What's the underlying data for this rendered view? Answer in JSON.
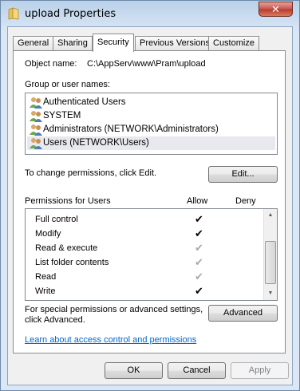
{
  "window": {
    "title": "upload Properties",
    "close_glyph": "✕"
  },
  "tabs": [
    {
      "label": "General"
    },
    {
      "label": "Sharing"
    },
    {
      "label": "Security"
    },
    {
      "label": "Previous Versions"
    },
    {
      "label": "Customize"
    }
  ],
  "object": {
    "label": "Object name:",
    "value": "C:\\AppServ\\www\\Pram\\upload"
  },
  "groups": {
    "label": "Group or user names:",
    "items": [
      {
        "label": "Authenticated Users",
        "icon": "users-icon"
      },
      {
        "label": "SYSTEM",
        "icon": "users-icon"
      },
      {
        "label": "Administrators (NETWORK\\Administrators)",
        "icon": "users-icon"
      },
      {
        "label": "Users (NETWORK\\Users)",
        "icon": "users-icon"
      }
    ]
  },
  "change_hint": "To change permissions, click Edit.",
  "edit_button": "Edit...",
  "permissions": {
    "label": "Permissions for Users",
    "allow_label": "Allow",
    "deny_label": "Deny",
    "check_glyph": "✔",
    "rows": [
      {
        "name": "Full control",
        "allow": "explicit"
      },
      {
        "name": "Modify",
        "allow": "explicit"
      },
      {
        "name": "Read & execute",
        "allow": "inherited"
      },
      {
        "name": "List folder contents",
        "allow": "inherited"
      },
      {
        "name": "Read",
        "allow": "inherited"
      },
      {
        "name": "Write",
        "allow": "explicit"
      }
    ]
  },
  "advanced": {
    "hint_line1": "For special permissions or advanced settings,",
    "hint_line2": "click Advanced.",
    "button": "Advanced"
  },
  "learn_link": "Learn about access control and permissions",
  "footer": {
    "ok": "OK",
    "cancel": "Cancel",
    "apply": "Apply"
  }
}
